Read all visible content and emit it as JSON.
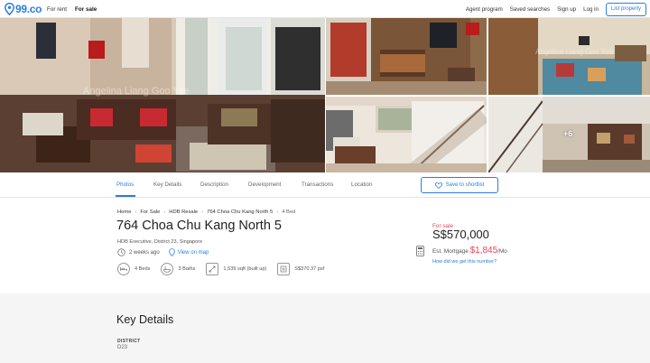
{
  "brand": {
    "name": "99.co",
    "accent": "#2a7de1",
    "sale_color": "#e8445a"
  },
  "nav": {
    "left": [
      {
        "label": "For rent",
        "active": false
      },
      {
        "label": "For sale",
        "active": true
      }
    ],
    "right": [
      {
        "label": "Agent program"
      },
      {
        "label": "Saved searches"
      },
      {
        "label": "Sign up"
      },
      {
        "label": "Log in"
      }
    ],
    "list_button": "List property"
  },
  "gallery": {
    "more_count": "+6",
    "watermark": "Angelina Liang Goo Yee",
    "watermark_short": "Angelina Liang Goo Yee"
  },
  "tabs": [
    {
      "label": "Photos",
      "active": true
    },
    {
      "label": "Key Details",
      "active": false
    },
    {
      "label": "Description",
      "active": false
    },
    {
      "label": "Development",
      "active": false
    },
    {
      "label": "Transactions",
      "active": false
    },
    {
      "label": "Location",
      "active": false
    }
  ],
  "shortlist_button": "Save to shortlist",
  "breadcrumb": {
    "items": [
      "Home",
      "For Sale",
      "HDB Resale",
      "764 Choa Chu Kang North 5"
    ],
    "last": "4 Bed"
  },
  "listing": {
    "title": "764 Choa Chu Kang North 5",
    "subtitle": "HDB Executive, District 23, Singapore",
    "posted": "2 weeks ago",
    "map_link": "View on map",
    "features": [
      {
        "icon": "bed-icon",
        "label": "4 Beds"
      },
      {
        "icon": "bath-icon",
        "label": "3 Baths"
      },
      {
        "icon": "area-icon",
        "label": "1,539 sqft (built up)"
      },
      {
        "icon": "psf-icon",
        "label": "S$370.37 psf"
      }
    ]
  },
  "pricing": {
    "status": "For sale",
    "price": "S$570,000",
    "mortgage_label": "Est. Mortgage",
    "mortgage_amount": "$1,845",
    "mortgage_suffix": "/Mo",
    "how_link": "How did we get this number?"
  },
  "key_details": {
    "title": "Key Details",
    "district_label": "DISTRICT",
    "district_value": "D23"
  }
}
